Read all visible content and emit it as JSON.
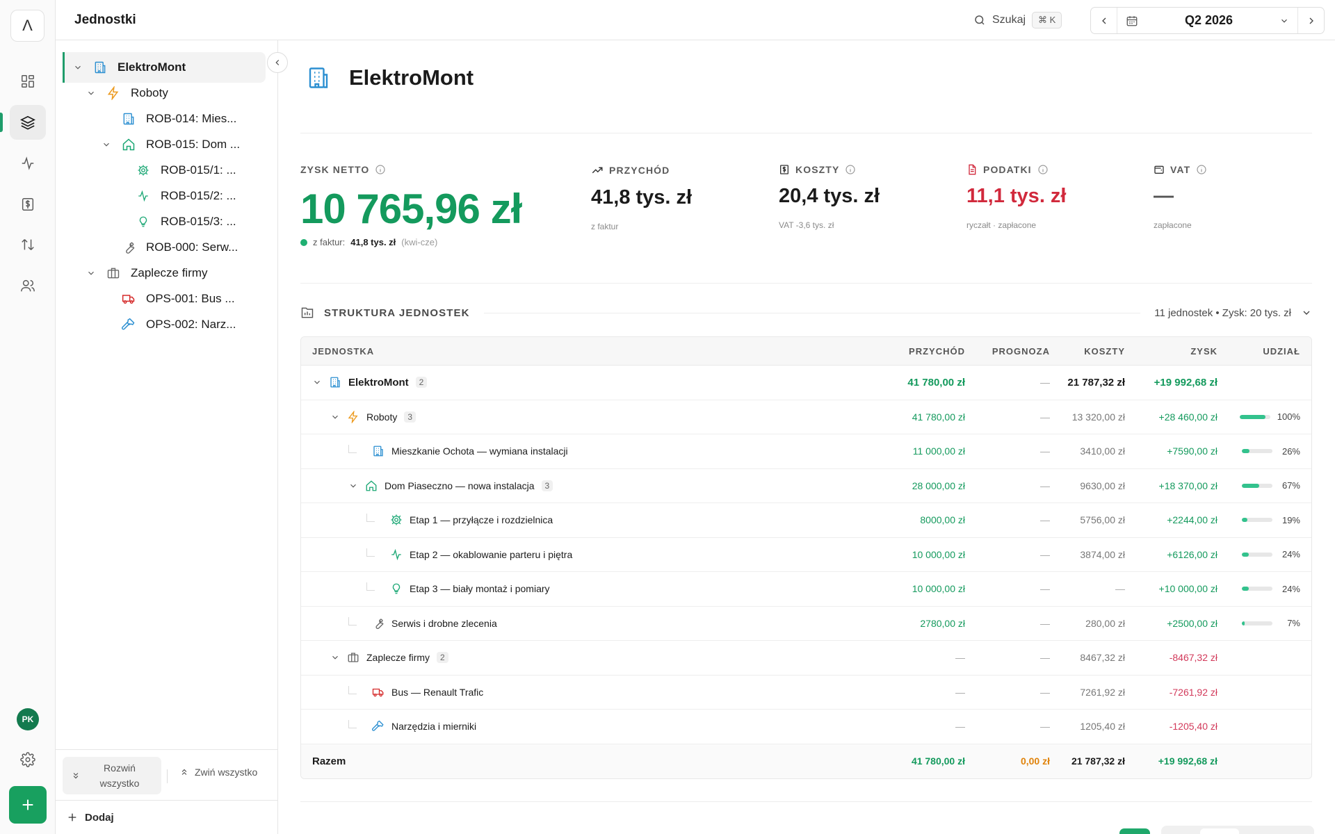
{
  "app": {
    "logo_letter": "Λ",
    "section_title": "Jednostki",
    "avatar_initials": "PK"
  },
  "search": {
    "label": "Szukaj",
    "shortcut": "⌘ K"
  },
  "period": {
    "value": "Q2 2026"
  },
  "tree": {
    "nodes": [
      {
        "label": "ElektroMont",
        "icon": "building-icon"
      },
      {
        "label": "Roboty",
        "icon": "bolt-icon"
      },
      {
        "label": "ROB-014: Mies...",
        "icon": "building-icon"
      },
      {
        "label": "ROB-015: Dom ...",
        "icon": "home-icon"
      },
      {
        "label": "ROB-015/1: ...",
        "icon": "gear-icon"
      },
      {
        "label": "ROB-015/2: ...",
        "icon": "activity-icon"
      },
      {
        "label": "ROB-015/3: ...",
        "icon": "lightbulb-icon"
      },
      {
        "label": "ROB-000: Serw...",
        "icon": "wrench-icon"
      },
      {
        "label": "Zaplecze firmy",
        "icon": "briefcase-icon"
      },
      {
        "label": "OPS-001: Bus ...",
        "icon": "truck-icon"
      },
      {
        "label": "OPS-002: Narz...",
        "icon": "hammer-icon"
      }
    ],
    "expand_all": "Rozwiń wszystko",
    "collapse_all": "Zwiń wszystko",
    "add": "Dodaj"
  },
  "entity": {
    "title": "ElektroMont"
  },
  "kpis": {
    "net_profit": {
      "label": "ZYSK NETTO",
      "value": "10 765,96 zł",
      "note_prefix": "z faktur:",
      "note_value": "41,8 tys. zł",
      "note_range": "(kwi-cze)"
    },
    "revenue": {
      "label": "PRZYCHÓD",
      "value": "41,8 tys. zł",
      "sub": "z faktur"
    },
    "costs": {
      "label": "KOSZTY",
      "value": "20,4 tys. zł",
      "sub": "VAT -3,6 tys. zł"
    },
    "taxes": {
      "label": "PODATKI",
      "value": "11,1 tys. zł",
      "sub": "ryczałt · zapłacone"
    },
    "vat": {
      "label": "VAT",
      "value": "—",
      "sub": "zapłacone"
    }
  },
  "structure": {
    "title": "STRUKTURA JEDNOSTEK",
    "summary": "11 jednostek • Zysk: 20 tys. zł",
    "columns": {
      "unit": "JEDNOSTKA",
      "revenue": "PRZYCHÓD",
      "forecast": "PROGNOZA",
      "costs": "KOSZTY",
      "profit": "ZYSK",
      "share": "UDZIAŁ"
    },
    "rows": [
      {
        "name": "ElektroMont",
        "count": "2",
        "revenue": "41 780,00 zł",
        "forecast": "—",
        "costs": "21 787,32 zł",
        "profit": "+19 992,68 zł",
        "share": ""
      },
      {
        "name": "Roboty",
        "count": "3",
        "revenue": "41 780,00 zł",
        "forecast": "—",
        "costs": "13 320,00 zł",
        "profit": "+28 460,00 zł",
        "share": "100%",
        "share_value": 100
      },
      {
        "name": "Mieszkanie Ochota — wymiana instalacji",
        "revenue": "11 000,00 zł",
        "forecast": "—",
        "costs": "3410,00 zł",
        "profit": "+7590,00 zł",
        "share": "26%",
        "share_value": 26
      },
      {
        "name": "Dom Piaseczno — nowa instalacja",
        "count": "3",
        "revenue": "28 000,00 zł",
        "forecast": "—",
        "costs": "9630,00 zł",
        "profit": "+18 370,00 zł",
        "share": "67%",
        "share_value": 67
      },
      {
        "name": "Etap 1 — przyłącze i rozdzielnica",
        "revenue": "8000,00 zł",
        "forecast": "—",
        "costs": "5756,00 zł",
        "profit": "+2244,00 zł",
        "share": "19%",
        "share_value": 19
      },
      {
        "name": "Etap 2 — okablowanie parteru i piętra",
        "revenue": "10 000,00 zł",
        "forecast": "—",
        "costs": "3874,00 zł",
        "profit": "+6126,00 zł",
        "share": "24%",
        "share_value": 24
      },
      {
        "name": "Etap 3 — biały montaż i pomiary",
        "revenue": "10 000,00 zł",
        "forecast": "—",
        "costs": "—",
        "profit": "+10 000,00 zł",
        "share": "24%",
        "share_value": 24
      },
      {
        "name": "Serwis i drobne zlecenia",
        "revenue": "2780,00 zł",
        "forecast": "—",
        "costs": "280,00 zł",
        "profit": "+2500,00 zł",
        "share": "7%",
        "share_value": 7
      },
      {
        "name": "Zaplecze firmy",
        "count": "2",
        "revenue": "—",
        "forecast": "—",
        "costs": "8467,32 zł",
        "profit": "-8467,32 zł",
        "share": ""
      },
      {
        "name": "Bus — Renault Trafic",
        "revenue": "—",
        "forecast": "—",
        "costs": "7261,92 zł",
        "profit": "-7261,92 zł",
        "share": ""
      },
      {
        "name": "Narzędzia i mierniki",
        "revenue": "—",
        "forecast": "—",
        "costs": "1205,40 zł",
        "profit": "-1205,40 zł",
        "share": ""
      }
    ],
    "total": {
      "label": "Razem",
      "revenue": "41 780,00 zł",
      "forecast": "0,00 zł",
      "costs": "21 787,32 zł",
      "profit": "+19 992,68 zł"
    }
  },
  "colors": {
    "accent": "#149a5d",
    "negative": "#d2395a",
    "tax": "#d1293c",
    "forecast_total": "#e0830b",
    "bar": "#33c28d"
  }
}
